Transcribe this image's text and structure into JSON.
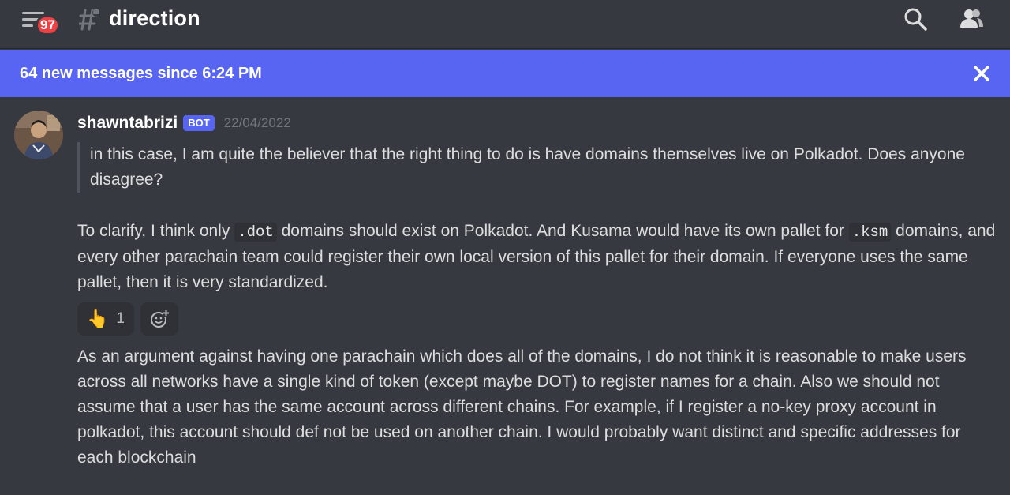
{
  "header": {
    "unread_count": "97",
    "channel_name": "direction",
    "icons": [
      "menu-icon",
      "thread-channel-icon",
      "search-icon",
      "members-icon"
    ]
  },
  "banner": {
    "text": "64 new messages since 6:24 PM",
    "close_icon": "close-icon",
    "color": "#5865f2"
  },
  "message": {
    "username": "shawntabrizi",
    "tag": "BOT",
    "timestamp": "22/04/2022",
    "quote": "in this case, I am quite the believer that the right thing to do is have domains themselves live on Polkadot. Does anyone disagree?",
    "para1": {
      "part1": "To clarify, I think only ",
      "code1": ".dot",
      "part2": " domains should exist on Polkadot. And Kusama would have its own pallet for ",
      "code2": ".ksm",
      "part3": " domains, and every other parachain team could register their own local version of this pallet for their domain. If everyone uses the same pallet, then it is very standardized."
    },
    "reaction": {
      "emoji": "👆",
      "count": "1"
    },
    "para2": "As an argument against having one parachain which does all of the domains, I do not think it is reasonable to make users across all networks have a single kind of token (except maybe DOT) to register names for a chain. Also we should not assume that a user has the same account across different chains. For example, if I register a no-key proxy account in polkadot, this account should def not be used on another chain. I would probably want distinct and specific addresses for each blockchain"
  },
  "colors": {
    "background": "#36393f",
    "accent": "#5865f2",
    "badge": "#ed4245"
  }
}
